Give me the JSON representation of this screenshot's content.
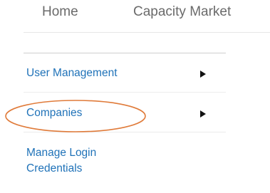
{
  "topnav": {
    "items": [
      {
        "label": "Home"
      },
      {
        "label": "Capacity Market"
      }
    ]
  },
  "submenu": {
    "items": [
      {
        "label": "User Management",
        "has_arrow": true
      },
      {
        "label": "Companies",
        "has_arrow": true,
        "highlighted": true
      },
      {
        "label": "Manage Login Credentials",
        "has_arrow": false
      }
    ]
  },
  "annotation": {
    "highlight_color": "#e07b3a",
    "link_color": "#1f72b8"
  }
}
